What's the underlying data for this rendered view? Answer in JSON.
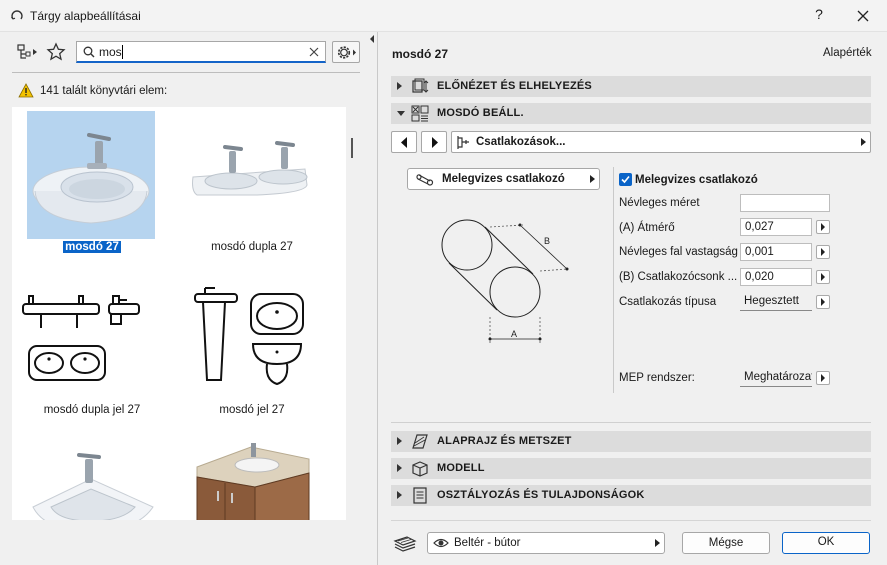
{
  "window": {
    "title": "Tárgy alapbeállításai",
    "help": "?"
  },
  "library": {
    "search_value": "mos",
    "found_text": "141 talált könyvtári elem:",
    "items": [
      {
        "label": "mosdó 27",
        "selected": true
      },
      {
        "label": "mosdó dupla 27",
        "selected": false
      },
      {
        "label": "mosdó dupla jel 27",
        "selected": false
      },
      {
        "label": "mosdó jel 27",
        "selected": false
      }
    ]
  },
  "settings": {
    "object_name": "mosdó 27",
    "defaults_label": "Alapérték",
    "sections": {
      "preview": "ELŐNÉZET ÉS ELHELYEZÉS",
      "sink_settings": "MOSDÓ BEÁLL.",
      "floorplan": "ALAPRAJZ ÉS METSZET",
      "model": "MODELL",
      "classification": "OSZTÁLYOZÁS ÉS TULAJDONSÁGOK"
    },
    "page_select": "Csatlakozások...",
    "connector_mode": "Melegvizes csatlakozó",
    "diagram": {
      "a_label": "A",
      "b_label": "B"
    },
    "checkbox_label": "Melegvizes csatlakozó",
    "checkbox_checked": true,
    "params": [
      {
        "label": "Névleges méret",
        "value": ""
      },
      {
        "label": "(A) Átmérő",
        "value": "0,027"
      },
      {
        "label": "Névleges fal vastagság",
        "value": "0,001"
      },
      {
        "label": "(B) Csatlakozócsonk ...",
        "value": "0,020"
      }
    ],
    "connection_type": {
      "label": "Csatlakozás típusa",
      "value": "Hegesztett"
    },
    "mep_system": {
      "label": "MEP rendszer:",
      "value": "Meghatározatlan"
    }
  },
  "footer": {
    "layer": "Beltér - bútor",
    "cancel": "Mégse",
    "ok": "OK"
  },
  "colors": {
    "accent": "#0a64c8",
    "selected_thumb_bg": "#b6d4ef"
  }
}
